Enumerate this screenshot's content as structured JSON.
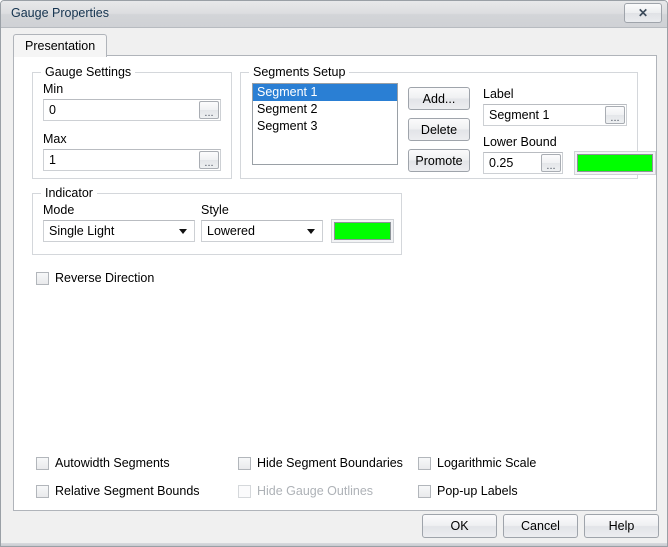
{
  "window": {
    "title": "Gauge Properties",
    "close_label": "✕"
  },
  "tabs": [
    {
      "label": "Presentation",
      "active": true
    }
  ],
  "gauge_settings": {
    "title": "Gauge Settings",
    "min_label": "Min",
    "min_value": "0",
    "max_label": "Max",
    "max_value": "1",
    "browse_label": "..."
  },
  "segments_setup": {
    "title": "Segments Setup",
    "items": [
      {
        "label": "Segment 1",
        "selected": true
      },
      {
        "label": "Segment 2",
        "selected": false
      },
      {
        "label": "Segment 3",
        "selected": false
      }
    ],
    "add_label": "Add...",
    "delete_label": "Delete",
    "promote_label": "Promote",
    "label_caption": "Label",
    "label_value": "Segment 1",
    "lower_bound_caption": "Lower Bound",
    "lower_bound_value": "0.25",
    "segment_color": "#00ff00",
    "browse_label": "..."
  },
  "indicator": {
    "title": "Indicator",
    "mode_label": "Mode",
    "mode_value": "Single Light",
    "style_label": "Style",
    "style_value": "Lowered",
    "indicator_color": "#00ff00"
  },
  "reverse_direction": {
    "label": "Reverse Direction",
    "checked": false
  },
  "options": [
    {
      "label": "Autowidth Segments",
      "checked": false,
      "disabled": false
    },
    {
      "label": "Relative Segment Bounds",
      "checked": false,
      "disabled": false
    },
    {
      "label": "Hide Segment Boundaries",
      "checked": false,
      "disabled": false
    },
    {
      "label": "Hide Gauge Outlines",
      "checked": false,
      "disabled": true
    },
    {
      "label": "Logarithmic Scale",
      "checked": false,
      "disabled": false
    },
    {
      "label": "Pop-up Labels",
      "checked": false,
      "disabled": false
    }
  ],
  "dialog_buttons": {
    "ok_label": "OK",
    "cancel_label": "Cancel",
    "help_label": "Help"
  }
}
